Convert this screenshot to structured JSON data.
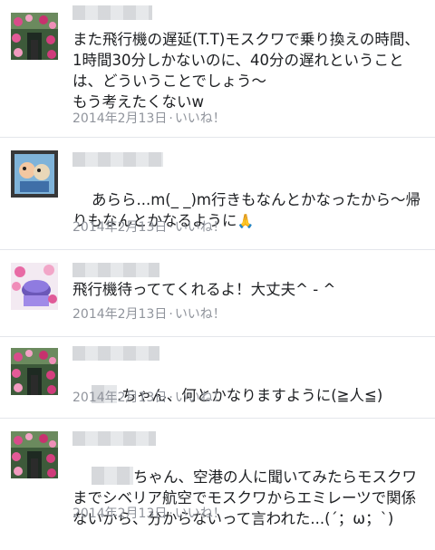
{
  "comments": [
    {
      "text": "また飛行機の遅延(T.T)モスクワで乗り換えの時間、1時間30分しかないのに、40分の遅れということは、どういうことでしょう〜\nもう考えたくないw",
      "date": "2014年2月13日",
      "separator": "·",
      "like": "いいね！"
    },
    {
      "text": "あらら...m(_ _)m行きもなんとかなったから〜帰りもなんとかなるように",
      "emoji": "🙏",
      "date": "2014年2月13日",
      "separator": "·",
      "like": "いいね！"
    },
    {
      "text": "飛行機待っててくれるよ！大丈夫^ - ^",
      "date": "2014年2月13日",
      "separator": "·",
      "like": "いいね！"
    },
    {
      "text": ".ちゃん、何とかなりますように(≧人≦)",
      "date": "2014年2月13日",
      "separator": "·",
      "like": "いいね！"
    },
    {
      "text": "ちゃん、空港の人に聞いてみたらモスクワまでシベリア航空でモスクワからエミレーツで関係ないから、分からないって言われた...(´；ω；`)",
      "date": "2014年2月13日",
      "separator": "·",
      "like": "いいね！"
    }
  ],
  "colors": {
    "text": "#1c1e21",
    "meta": "#90949c",
    "divider": "#e4e6eb"
  }
}
